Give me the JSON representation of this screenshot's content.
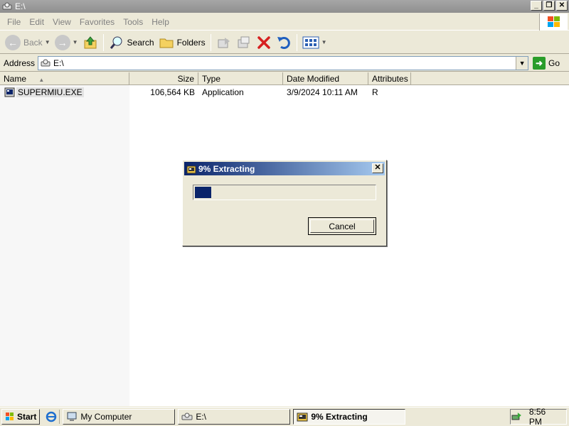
{
  "window": {
    "title": "E:\\",
    "controls": [
      "_",
      "❐",
      "✕"
    ]
  },
  "menu": [
    "File",
    "Edit",
    "View",
    "Favorites",
    "Tools",
    "Help"
  ],
  "toolbar": {
    "back": "Back",
    "search": "Search",
    "folders": "Folders"
  },
  "address": {
    "label": "Address",
    "value": "E:\\",
    "go": "Go"
  },
  "columns": [
    "Name",
    "Size",
    "Type",
    "Date Modified",
    "Attributes"
  ],
  "files": [
    {
      "name": "SUPERMIU.EXE",
      "size": "106,564 KB",
      "type": "Application",
      "date": "3/9/2024 10:11 AM",
      "attributes": "R"
    }
  ],
  "dialog": {
    "title": "9% Extracting",
    "progress_fraction": 0.09,
    "cancel": "Cancel"
  },
  "taskbar": {
    "start": "Start",
    "items": [
      {
        "label": "My Computer",
        "active": false
      },
      {
        "label": "E:\\",
        "active": false
      },
      {
        "label": "9% Extracting",
        "active": true
      }
    ],
    "clock": "8:56 PM"
  }
}
